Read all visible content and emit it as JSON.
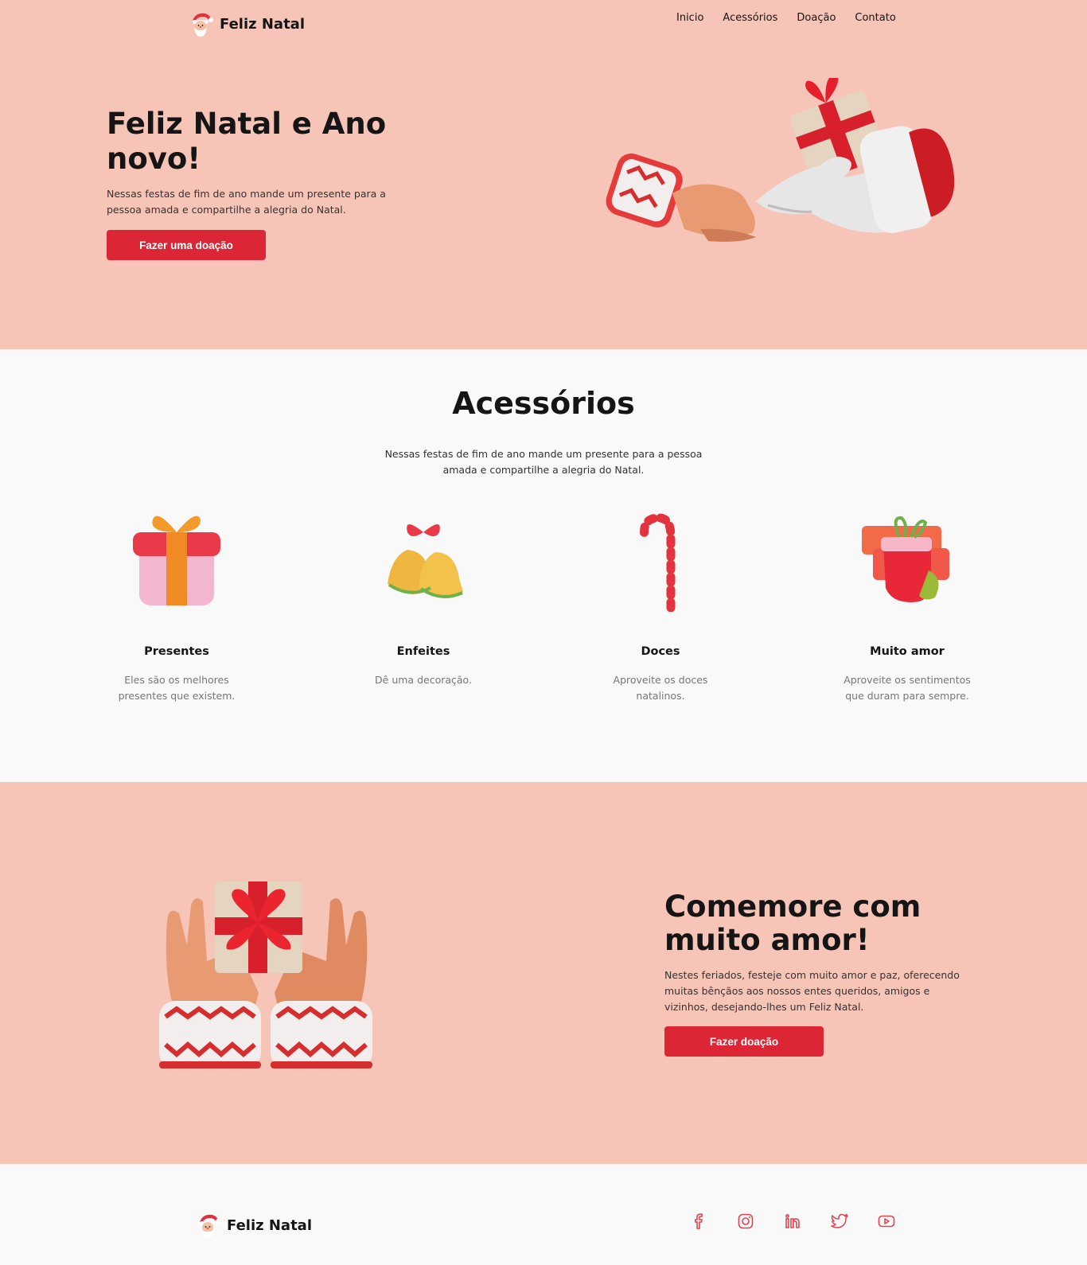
{
  "brand": {
    "name": "Feliz Natal"
  },
  "nav": {
    "items": [
      {
        "label": "Inicio"
      },
      {
        "label": "Acessórios"
      },
      {
        "label": "Doação"
      },
      {
        "label": "Contato"
      }
    ]
  },
  "hero": {
    "title": "Feliz Natal e Ano novo!",
    "description": "Nessas festas de fim de ano mande um presente para a pessoa amada e compartilhe a alegria do Natal.",
    "button_label": "Fazer uma doação",
    "image_icon": "gift-handover-illustration"
  },
  "accessories": {
    "title": "Acessórios",
    "description": "Nessas festas de fim de ano mande um presente para a pessoa amada e compartilhe a alegria do Natal.",
    "cards": [
      {
        "icon": "gift-box-icon",
        "name": "Presentes",
        "text": "Eles são os melhores presentes que existem."
      },
      {
        "icon": "bells-icon",
        "name": "Enfeites",
        "text": "Dê uma decoração."
      },
      {
        "icon": "candy-cane-icon",
        "name": "Doces",
        "text": "Aproveite os doces natalinos."
      },
      {
        "icon": "stocking-icon",
        "name": "Muito amor",
        "text": "Aproveite os sentimentos que duram para sempre."
      }
    ]
  },
  "celebrate": {
    "title": "Comemore com muito amor!",
    "description": "Nestes feriados, festeje com muito amor e paz, oferecendo muitas bênçãos aos nossos entes queridos, amigos e vizinhos, desejando-lhes um Feliz Natal.",
    "button_label": "Fazer doação",
    "image_icon": "hands-holding-gift-illustration"
  },
  "footer": {
    "brand": "Feliz Natal",
    "social": [
      "facebook-icon",
      "instagram-icon",
      "linkedin-icon",
      "twitter-icon",
      "youtube-icon"
    ]
  },
  "colors": {
    "pink_bg": "#f7c5b8",
    "light_bg": "#f9f9f9",
    "accent_red": "#dc2636",
    "text_dark": "#151515",
    "text_muted": "#777777"
  }
}
